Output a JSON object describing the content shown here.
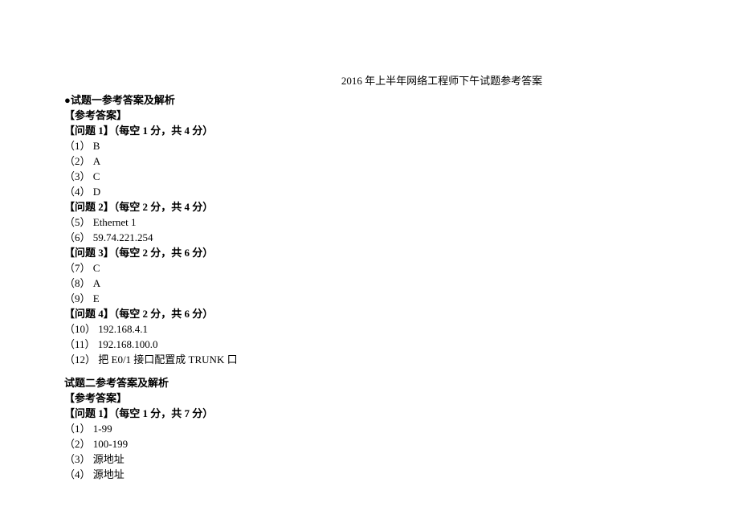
{
  "title": "2016 年上半年网络工程师下午试题参考答案",
  "sections": [
    {
      "header_bullet": "●试题一参考答案及解析",
      "subheader": "【参考答案】",
      "groups": [
        {
          "heading": "【问题 1】（每空 1 分，共 4 分）",
          "lines": [
            "（1） B",
            "（2） A",
            "（3） C",
            "（4） D"
          ]
        },
        {
          "heading": "【问题 2】（每空 2 分，共 4 分）",
          "lines": [
            "（5） Ethernet 1",
            "（6） 59.74.221.254"
          ]
        },
        {
          "heading": "【问题 3】（每空 2 分，共 6 分）",
          "lines": [
            "（7） C",
            "（8） A",
            "（9） E"
          ]
        },
        {
          "heading": "【问题 4】（每空 2 分，共 6 分）",
          "lines": [
            "（10） 192.168.4.1",
            "（11） 192.168.100.0",
            "（12） 把 E0/1 接口配置成 TRUNK 口"
          ]
        }
      ]
    },
    {
      "header_bullet": "试题二参考答案及解析",
      "subheader": "【参考答案】",
      "groups": [
        {
          "heading": "【问题 1】（每空 1 分，共 7 分）",
          "lines": [
            "（1） 1-99",
            "（2） 100-199",
            "（3） 源地址",
            "（4） 源地址"
          ]
        }
      ]
    }
  ]
}
